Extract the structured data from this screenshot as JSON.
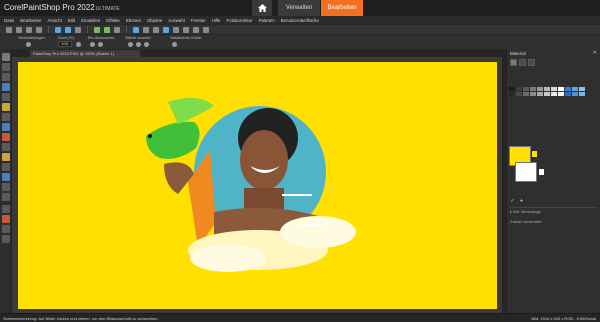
{
  "app": {
    "brand_prefix": "Corel",
    "brand_name": "PaintShop",
    "brand_pro": "Pro 2022",
    "brand_edition": "ULTIMATE"
  },
  "tabs": {
    "manage": "Verwalten",
    "edit": "Bearbeiten"
  },
  "menu": [
    "Datei",
    "Bearbeiten",
    "Ansicht",
    "Bild",
    "Einstellen",
    "Effekte",
    "Ebenen",
    "Objekte",
    "Auswahl",
    "Fenster",
    "Hilfe",
    "Fotokorrektur",
    "Paletten",
    "Benutzeroberfläche"
  ],
  "options": {
    "presets_label": "Voreinstellungen:",
    "zoom_label": "Zoom (%):",
    "zoom_value": "100",
    "zoom_more_label": "Ein-/Auszoomen:",
    "zoom_less_label": "Stärker zoomen:",
    "actual_size_label": "Tatsächliche Größe:"
  },
  "document": {
    "tab_label": "PaintShop Pro 2022.PNG @ 100% (Raster 1)"
  },
  "materials": {
    "title": "Material",
    "all_tools": "Alle Werkzeuge",
    "recently_used": "Zuletzt verwendet"
  },
  "status": {
    "left": "Schwenkwerkzeug: Auf Bilder klicken und ziehen, um den Bildausschnitt zu schwenken.",
    "right": "Bild: 1516 x 845 x RGB - 8 Bit/Kanal"
  },
  "colors": {
    "accent": "#f37021",
    "canvas_bg": "#ffe000",
    "foreground_material": "#ffe000",
    "background_material": "#ffffff"
  },
  "icons": {
    "home": "home-icon",
    "pan": "pan-icon",
    "close": "close-icon"
  }
}
